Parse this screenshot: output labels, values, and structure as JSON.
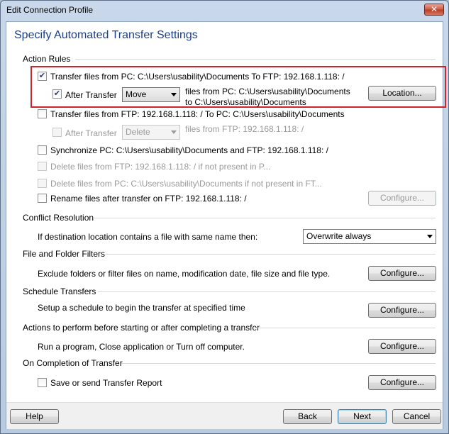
{
  "window": {
    "title": "Edit Connection Profile",
    "close_glyph": "✕"
  },
  "heading": "Specify Automated Transfer Settings",
  "sections": {
    "action_rules": "Action Rules",
    "conflict": "Conflict Resolution",
    "filters": "File and Folder Filters",
    "schedule": "Schedule Transfers",
    "actions": "Actions to perform before starting or after completing a transfer",
    "completion": "On Completion of Transfer"
  },
  "rules": {
    "r1": {
      "label": "Transfer files from PC: C:\\Users\\usability\\Documents  To  FTP: 192.168.1.118: /",
      "checked": true
    },
    "r1_after": {
      "label": "After Transfer",
      "checked": true,
      "select": "Move",
      "desc1": "files from PC: C:\\Users\\usability\\Documents",
      "desc2": "to C:\\Users\\usability\\Documents",
      "button": "Location..."
    },
    "r2": {
      "label": "Transfer files from FTP: 192.168.1.118: /  To  PC: C:\\Users\\usability\\Documents",
      "checked": false
    },
    "r2_after": {
      "label": "After Transfer",
      "select": "Delete",
      "desc": "files from FTP: 192.168.1.118: /"
    },
    "r3": {
      "label": "Synchronize PC: C:\\Users\\usability\\Documents and FTP: 192.168.1.118: /"
    },
    "r4": {
      "label": "Delete files from FTP: 192.168.1.118: / if not present in P..."
    },
    "r5": {
      "label": "Delete files from PC: C:\\Users\\usability\\Documents if not present in FT..."
    },
    "r6": {
      "label": "Rename files after transfer on FTP: 192.168.1.118: /",
      "button": "Configure..."
    }
  },
  "conflict": {
    "label": "If destination location contains a file with same name then:",
    "select": "Overwrite always"
  },
  "filters": {
    "label": "Exclude folders or filter files on name, modification date, file size and file type.",
    "button": "Configure..."
  },
  "schedule": {
    "label": "Setup a schedule to begin the transfer at specified time",
    "button": "Configure..."
  },
  "actions": {
    "label": "Run a program, Close application or Turn off computer.",
    "button": "Configure..."
  },
  "completion": {
    "label": "Save or send Transfer Report",
    "button": "Configure..."
  },
  "footer": {
    "help": "Help",
    "back": "Back",
    "next": "Next",
    "cancel": "Cancel"
  },
  "colors": {
    "heading": "#1a3e8c",
    "highlight": "#d1232a"
  }
}
